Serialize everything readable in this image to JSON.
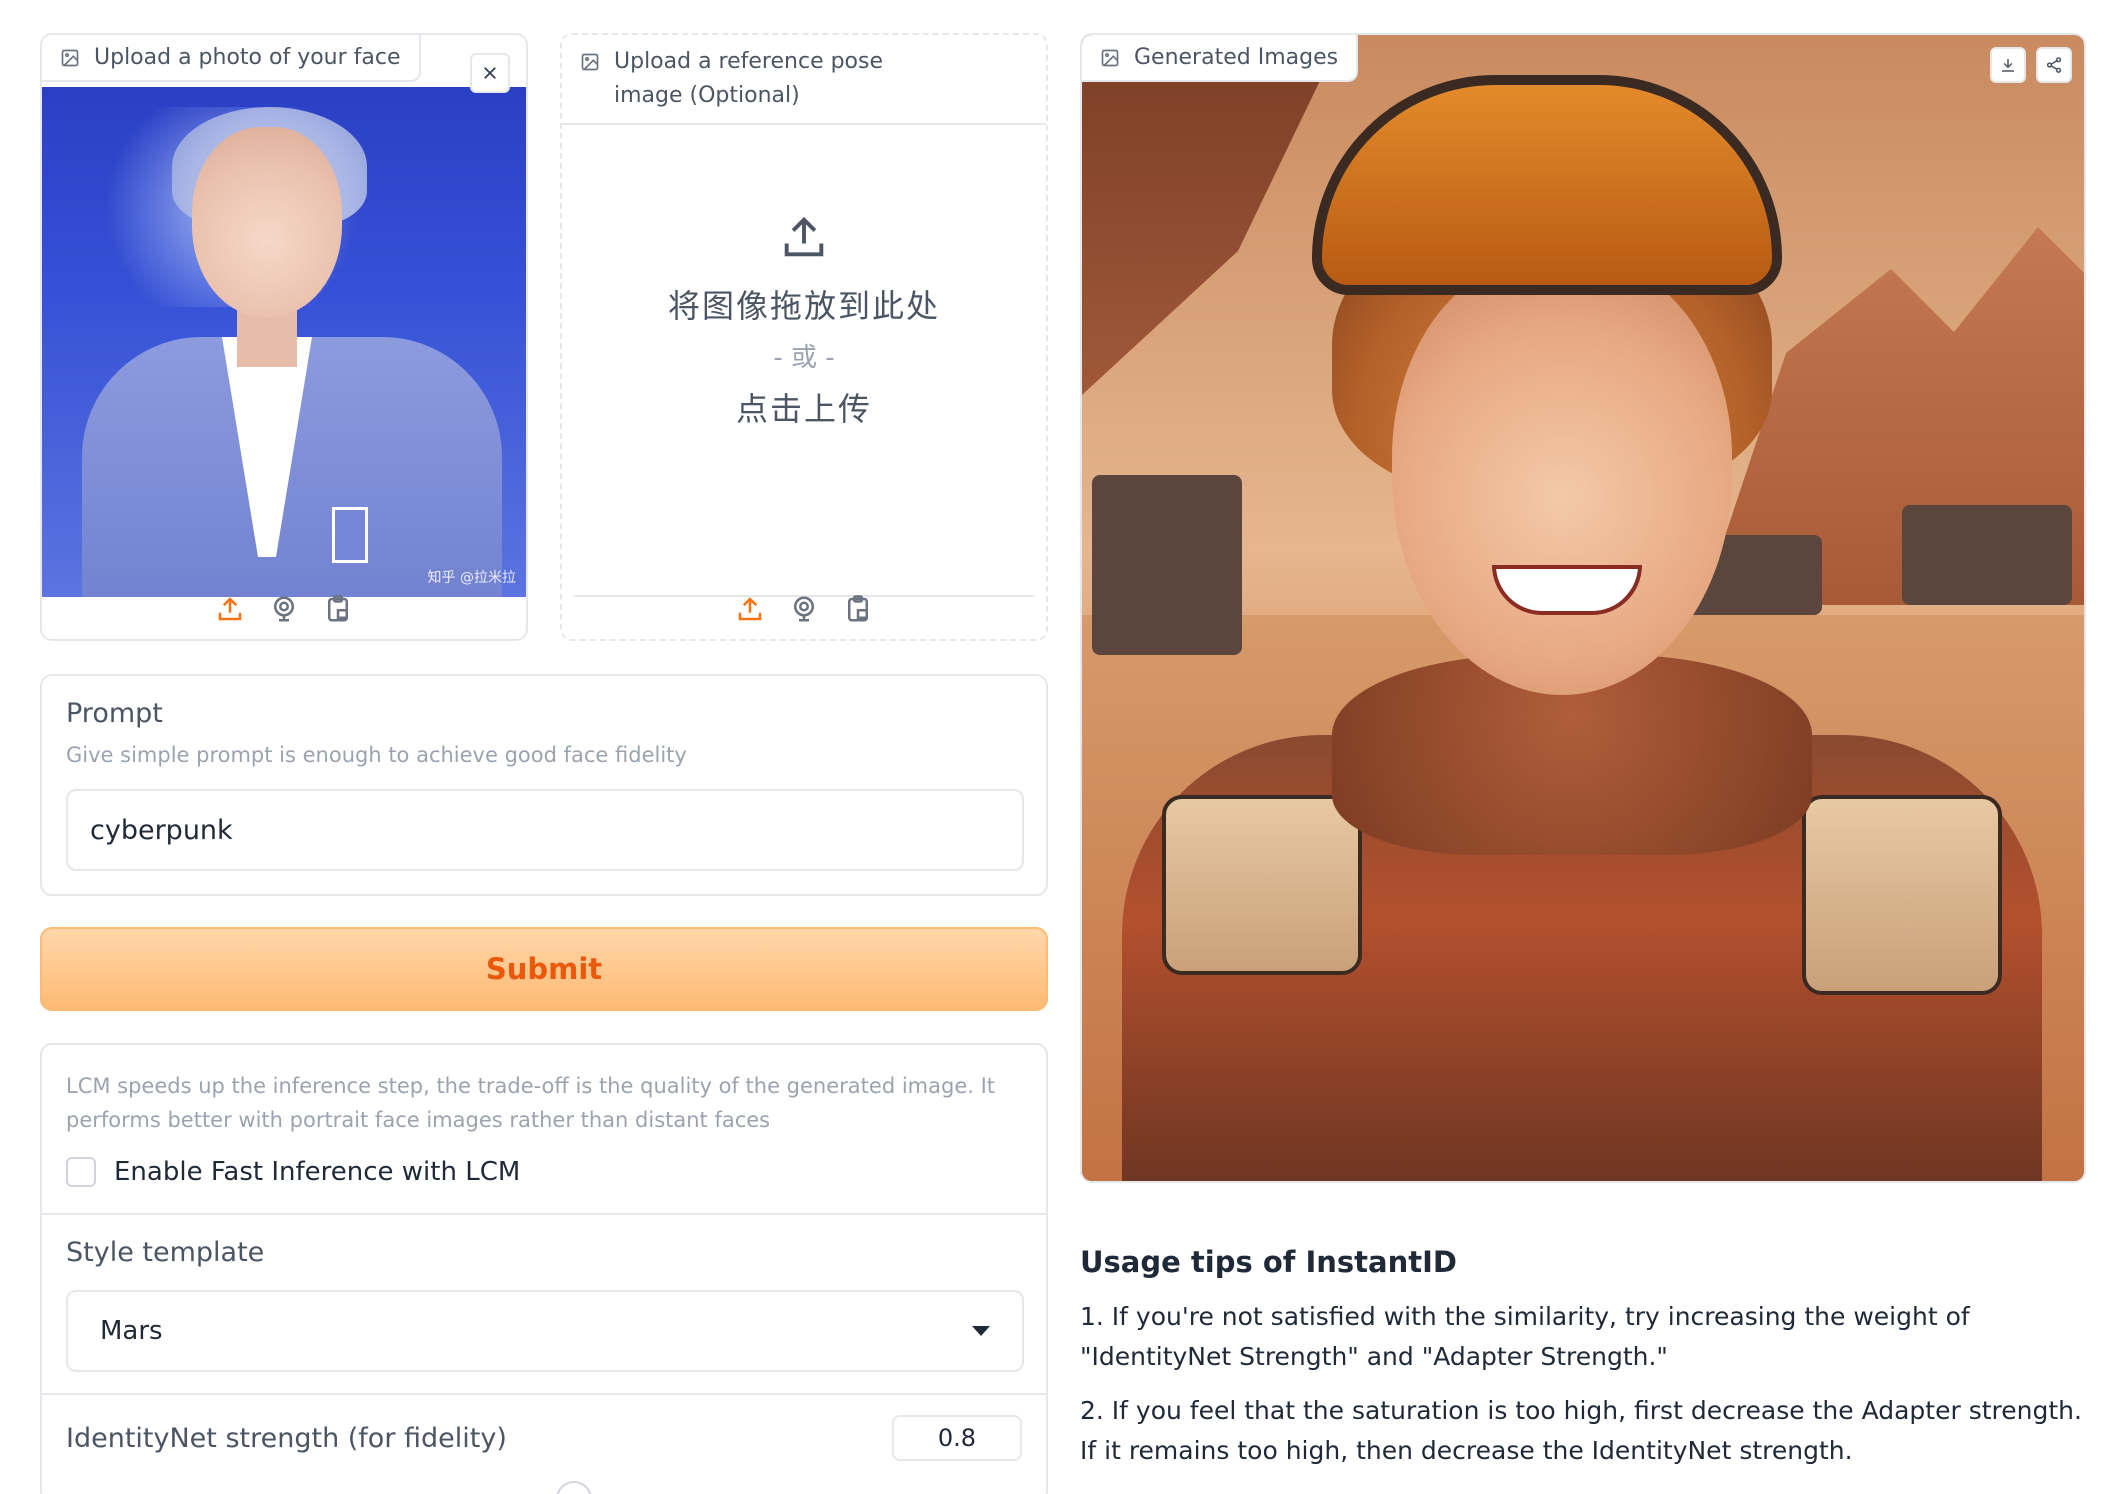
{
  "face_upload": {
    "label": "Upload a photo of your face",
    "watermark": "知乎 @拉米拉",
    "close_icon": "close-icon",
    "tools": [
      "upload-icon",
      "webcam-icon",
      "clipboard-icon"
    ]
  },
  "pose_upload": {
    "label": "Upload a reference pose image (Optional)",
    "drop_text": "将图像拖放到此处",
    "or_text": "- 或 -",
    "click_text": "点击上传",
    "tools": [
      "upload-icon",
      "webcam-icon",
      "clipboard-icon"
    ]
  },
  "prompt": {
    "label": "Prompt",
    "info": "Give simple prompt is enough to achieve good face fidelity",
    "value": "cyberpunk"
  },
  "submit": {
    "label": "Submit"
  },
  "lcm": {
    "info": "LCM speeds up the inference step, the trade-off is the quality of the generated image. It performs better with portrait face images rather than distant faces",
    "checkbox_label": "Enable Fast Inference with LCM",
    "checked": false
  },
  "style": {
    "label": "Style template",
    "value": "Mars"
  },
  "identitynet": {
    "label": "IdentityNet strength (for fidelity)",
    "value": "0.8",
    "fraction": 0.53
  },
  "generated": {
    "label": "Generated Images",
    "actions": [
      "download-icon",
      "share-icon"
    ]
  },
  "tips": {
    "title": "Usage tips of InstantID",
    "items": [
      "1. If you're not satisfied with the similarity, try increasing the weight of \"IdentityNet Strength\" and \"Adapter Strength.\"",
      "2. If you feel that the saturation is too high, first decrease the Adapter strength. If it remains too high, then decrease the IdentityNet strength."
    ]
  },
  "colors": {
    "accent": "#f97316",
    "submit_bg": "#fdba74",
    "submit_text": "#ea580c",
    "slider_fill": "#2563eb"
  }
}
